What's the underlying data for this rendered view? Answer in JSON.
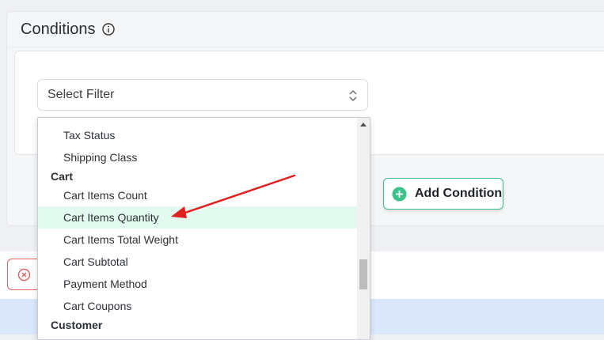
{
  "conditions": {
    "title": "Conditions"
  },
  "filter": {
    "placeholder": "Select Filter"
  },
  "dropdown": {
    "options": [
      {
        "label": "Tax Status",
        "type": "item"
      },
      {
        "label": "Shipping Class",
        "type": "item"
      },
      {
        "label": "Cart",
        "type": "group"
      },
      {
        "label": "Cart Items Count",
        "type": "item"
      },
      {
        "label": "Cart Items Quantity",
        "type": "item",
        "highlighted": true
      },
      {
        "label": "Cart Items Total Weight",
        "type": "item"
      },
      {
        "label": "Cart Subtotal",
        "type": "item"
      },
      {
        "label": "Payment Method",
        "type": "item"
      },
      {
        "label": "Cart Coupons",
        "type": "item"
      },
      {
        "label": "Customer",
        "type": "group"
      }
    ]
  },
  "add_condition": {
    "label": "Add Condition"
  },
  "colors": {
    "accent": "#3cc18a",
    "highlight": "#e3faf0",
    "arrow": "#e02020",
    "danger": "#e06060"
  },
  "icons": [
    "info-icon",
    "chevron-updown-icon",
    "plus-circle-icon",
    "close-circle-icon",
    "scroll-up-icon"
  ]
}
